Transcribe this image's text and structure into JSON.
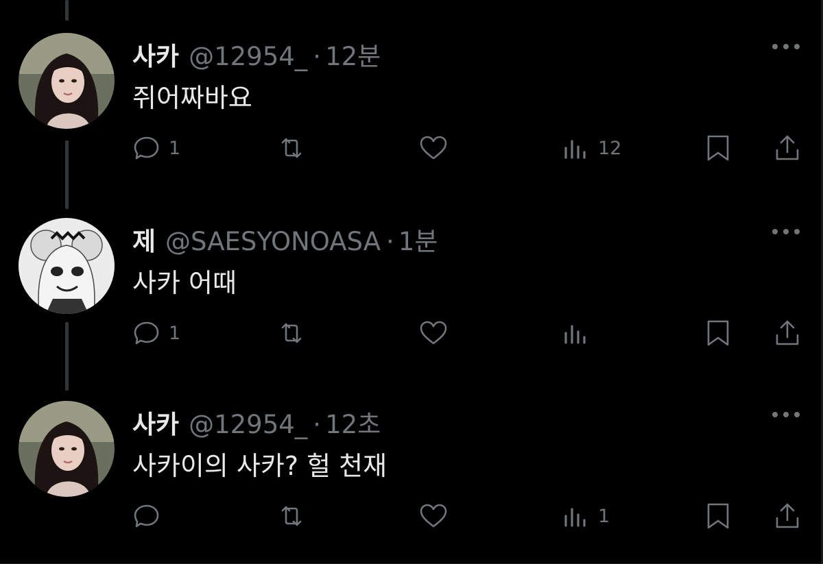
{
  "colors": {
    "background": "#000000",
    "text": "#e7e9ea",
    "muted": "#71767b",
    "thread_line": "#333639"
  },
  "tweets": [
    {
      "name": "사카",
      "handle": "@12954_",
      "separator": "·",
      "time": "12분",
      "text": "쥐어짜바요",
      "avatar_icon": "photo-avatar",
      "reply_count": "1",
      "retweet_count": "",
      "like_count": "",
      "view_count": "12"
    },
    {
      "name": "제",
      "handle": "@SAESYONOASA",
      "separator": "·",
      "time": "1분",
      "text": "사카 어때",
      "avatar_icon": "manga-avatar",
      "reply_count": "1",
      "retweet_count": "",
      "like_count": "",
      "view_count": ""
    },
    {
      "name": "사카",
      "handle": "@12954_",
      "separator": "·",
      "time": "12초",
      "text": "사카이의 사카? 헐 천재",
      "avatar_icon": "photo-avatar",
      "reply_count": "",
      "retweet_count": "",
      "like_count": "",
      "view_count": "1"
    }
  ]
}
